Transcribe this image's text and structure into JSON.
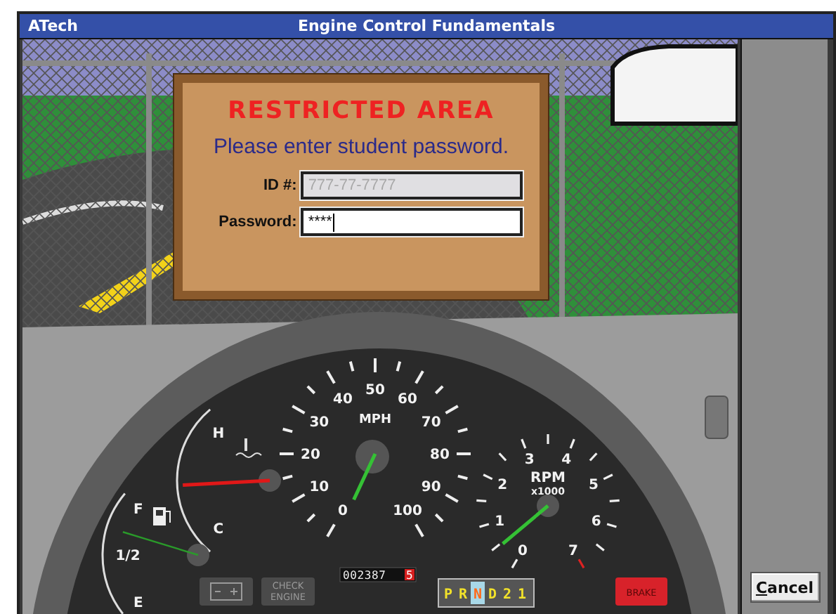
{
  "window": {
    "app_name": "ATech",
    "title": "Engine Control Fundamentals"
  },
  "login_dialog": {
    "heading": "RESTRICTED AREA",
    "prompt": "Please enter student password.",
    "fields": [
      {
        "label": "ID #:",
        "placeholder": "777-77-7777",
        "disabled": true,
        "focused": false
      },
      {
        "label": "Password:",
        "value": "****",
        "disabled": false,
        "focused": true
      }
    ]
  },
  "dashboard": {
    "speedometer": {
      "unit": "MPH",
      "labels": [
        "0",
        "10",
        "20",
        "30",
        "40",
        "50",
        "60",
        "70",
        "80",
        "90",
        "100"
      ]
    },
    "tachometer": {
      "unit": "RPM",
      "scale": "x1000",
      "labels": [
        "0",
        "1",
        "2",
        "3",
        "4",
        "5",
        "6",
        "7"
      ]
    },
    "temperature_gauge": {
      "hot_label": "H",
      "cold_label": "C"
    },
    "fuel_gauge": {
      "full_label": "F",
      "half_label": "1/2",
      "empty_label": "E"
    },
    "odometer": {
      "digits": "002387",
      "tenths": "5"
    },
    "gear_selector": [
      {
        "label": "P",
        "selected": false
      },
      {
        "label": "R",
        "selected": false
      },
      {
        "label": "N",
        "selected": true
      },
      {
        "label": "D",
        "selected": false
      },
      {
        "label": "2",
        "selected": false
      },
      {
        "label": "1",
        "selected": false
      }
    ],
    "warning_lights": [
      {
        "kind": "battery",
        "lit": false
      },
      {
        "kind": "text",
        "label": "CHECK ENGINE",
        "lit": false
      },
      {
        "kind": "text",
        "label": "BRAKE",
        "lit": true
      }
    ]
  },
  "buttons": [
    {
      "label": "Cancel",
      "underline_first": true
    }
  ]
}
